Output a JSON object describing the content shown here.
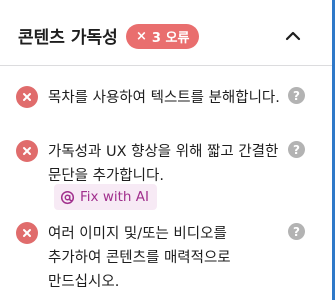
{
  "section": {
    "title": "콘텐츠 가독성",
    "badge": {
      "symbol": "×",
      "label": "3 오류"
    },
    "toggle_icon": "chevron-up-icon"
  },
  "issues": [
    {
      "text": "목차를 사용하여 텍스트를 분해합니다.",
      "status_icon": "error-circle-x-icon",
      "help_icon": "help-question-icon"
    },
    {
      "text": "가독성과 UX 향상을 위해 짧고 간결한 문단을 추가합니다.",
      "status_icon": "error-circle-x-icon",
      "help_icon": "help-question-icon",
      "action": {
        "label": "Fix with AI",
        "icon": "ai-sparkle-icon"
      }
    },
    {
      "text": "여러 이미지 및/또는 비디오를 추가하여 콘텐츠를 매력적으로 만드십시오.",
      "status_icon": "error-circle-x-icon",
      "help_icon": "help-question-icon"
    }
  ],
  "colors": {
    "error": "#e06c6c",
    "badge": "#e96e6e",
    "help": "#b3b3b3",
    "ai_accent": "#a1308d",
    "ai_background": "#f7eaf5",
    "focus_border": "#2f79c9"
  }
}
